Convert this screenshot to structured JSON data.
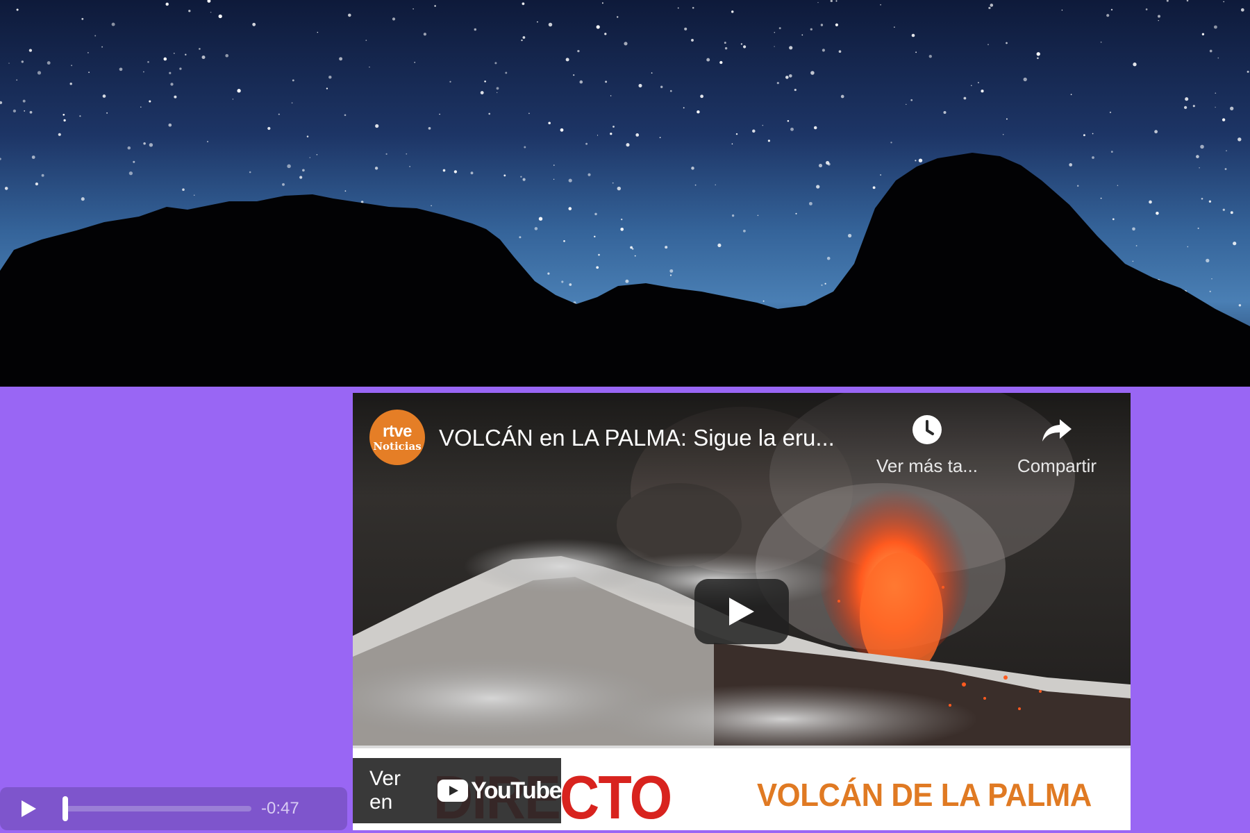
{
  "colors": {
    "page_background": "#9966f4",
    "channel_accent": "#e57e26",
    "banner_red": "#d8231e",
    "banner_orange": "#e07a23",
    "audio_player_bg": "#7e55cc"
  },
  "hero": {
    "description_icon": "night-sky-mountains-image"
  },
  "video": {
    "channel_logo_line1": "rtve",
    "channel_logo_line2": "Noticias",
    "title": "VOLCÁN en LA PALMA: Sigue la eru...",
    "watch_later_label": "Ver más ta...",
    "watch_later_icon": "clock-icon",
    "share_label": "Compartir",
    "share_icon": "share-arrow-icon",
    "play_icon": "play-icon",
    "banner_left_text": "DIRECTO",
    "banner_right_text": "VOLCÁN DE LA PALMA",
    "watch_on_label": "Ver en",
    "youtube_word": "YouTube"
  },
  "audio": {
    "play_icon": "play-icon",
    "progress": 0,
    "time_remaining": "-0:47"
  }
}
